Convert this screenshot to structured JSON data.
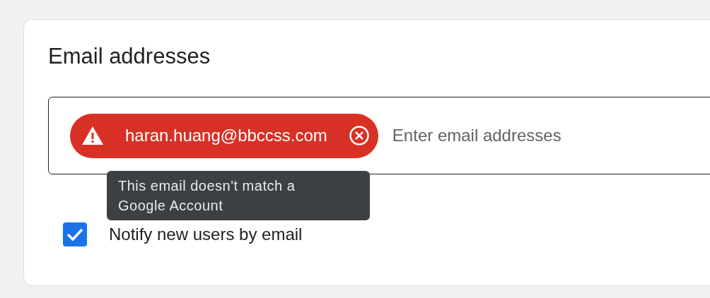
{
  "card": {
    "title": "Email addresses",
    "field": {
      "placeholder": "Enter email addresses",
      "chips": [
        {
          "email": "haran.huang@bbccss.com",
          "invalid": true,
          "tooltip": "This email doesn't match a Google Account"
        }
      ]
    },
    "notify": {
      "label": "Notify new users by email",
      "checked": true
    }
  }
}
